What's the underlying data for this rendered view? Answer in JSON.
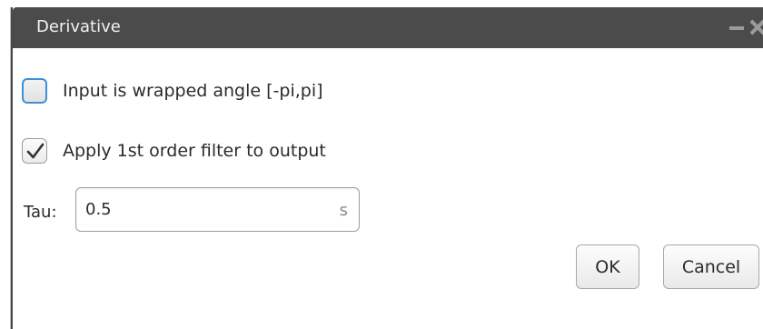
{
  "window": {
    "title": "Derivative"
  },
  "options": {
    "wrapped_angle": {
      "label": "Input is wrapped angle [-pi,pi]",
      "checked": false
    },
    "apply_filter": {
      "label": "Apply 1st order filter to output",
      "checked": true
    }
  },
  "tau": {
    "label": "Tau:",
    "value": "0.5",
    "unit": "s"
  },
  "buttons": {
    "ok_label": "OK",
    "cancel_label": "Cancel"
  },
  "colors": {
    "titlebar": "#4b4b4b",
    "focus_accent": "#3f8fd6"
  }
}
